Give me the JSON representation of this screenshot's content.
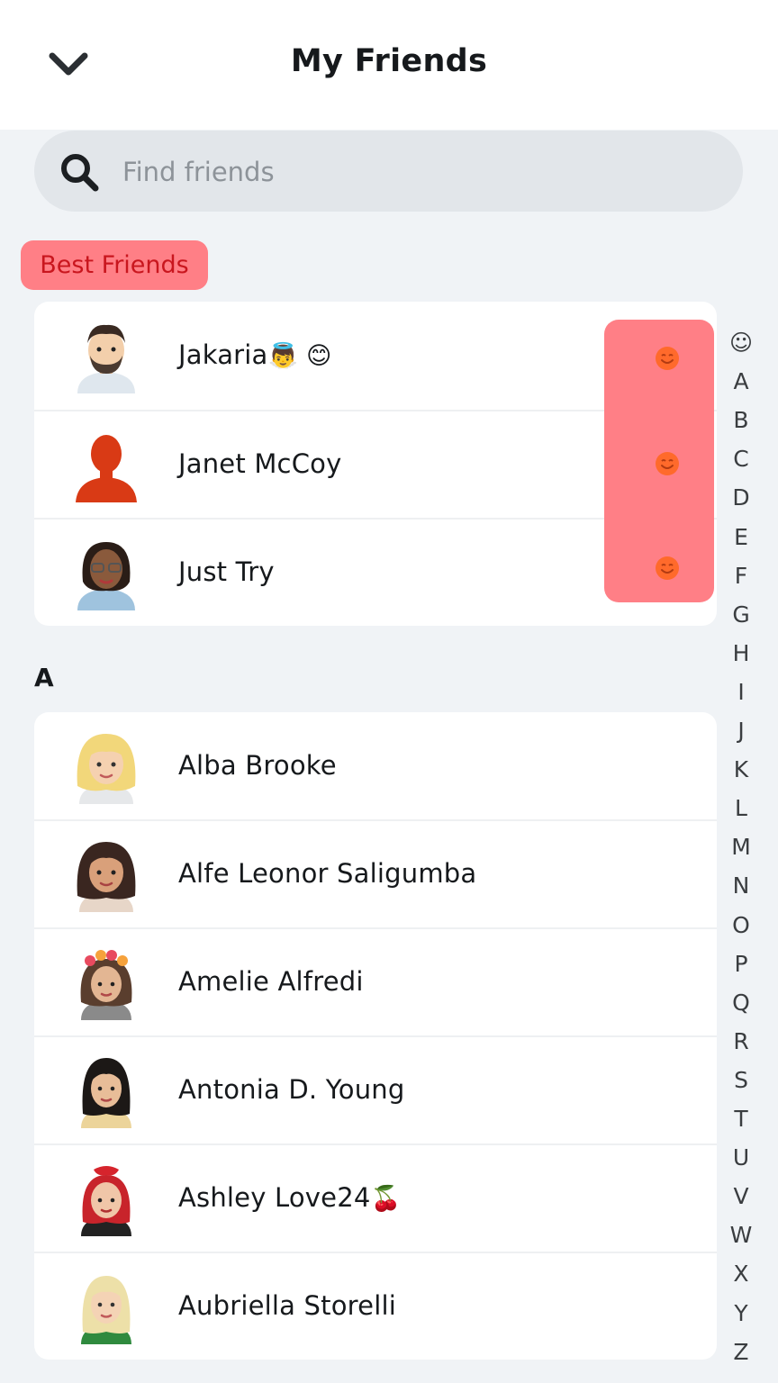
{
  "header": {
    "title": "My Friends",
    "back_icon": "chevron-down-icon"
  },
  "search": {
    "placeholder": "Find friends",
    "icon": "search-icon"
  },
  "best_friends": {
    "label": "Best Friends",
    "highlight_color": "#ff7f86",
    "friends": [
      {
        "name": "Jakaria",
        "emoji": "👼 😊",
        "avatar": "bitmoji-man-beard"
      },
      {
        "name": "Janet McCoy",
        "emoji": "",
        "avatar": "default-silhouette"
      },
      {
        "name": "Just Try",
        "emoji": "",
        "avatar": "bitmoji-woman-glasses"
      }
    ]
  },
  "sections": [
    {
      "letter": "A",
      "friends": [
        {
          "name": "Alba Brooke",
          "emoji": "",
          "avatar": "bitmoji-blonde-woman"
        },
        {
          "name": "Alfe Leonor Saligumba",
          "emoji": "",
          "avatar": "bitmoji-brunette-woman"
        },
        {
          "name": "Amelie Alfredi",
          "emoji": "",
          "avatar": "bitmoji-flower-crown"
        },
        {
          "name": "Antonia D. Young",
          "emoji": "",
          "avatar": "bitmoji-dark-hair-woman"
        },
        {
          "name": "Ashley Love24",
          "emoji": "🍒",
          "avatar": "bitmoji-red-hair-woman"
        },
        {
          "name": "Aubriella Storelli",
          "emoji": "",
          "avatar": "bitmoji-light-hair-woman"
        }
      ]
    }
  ],
  "alphabet_index": [
    "☺",
    "A",
    "B",
    "C",
    "D",
    "E",
    "F",
    "G",
    "H",
    "I",
    "J",
    "K",
    "L",
    "M",
    "N",
    "O",
    "P",
    "Q",
    "R",
    "S",
    "T",
    "U",
    "V",
    "W",
    "X",
    "Y",
    "Z"
  ],
  "colors": {
    "accent_red": "#ff7f86",
    "badge_text": "#c9161e",
    "streak_orange": "#ff6a2b"
  }
}
